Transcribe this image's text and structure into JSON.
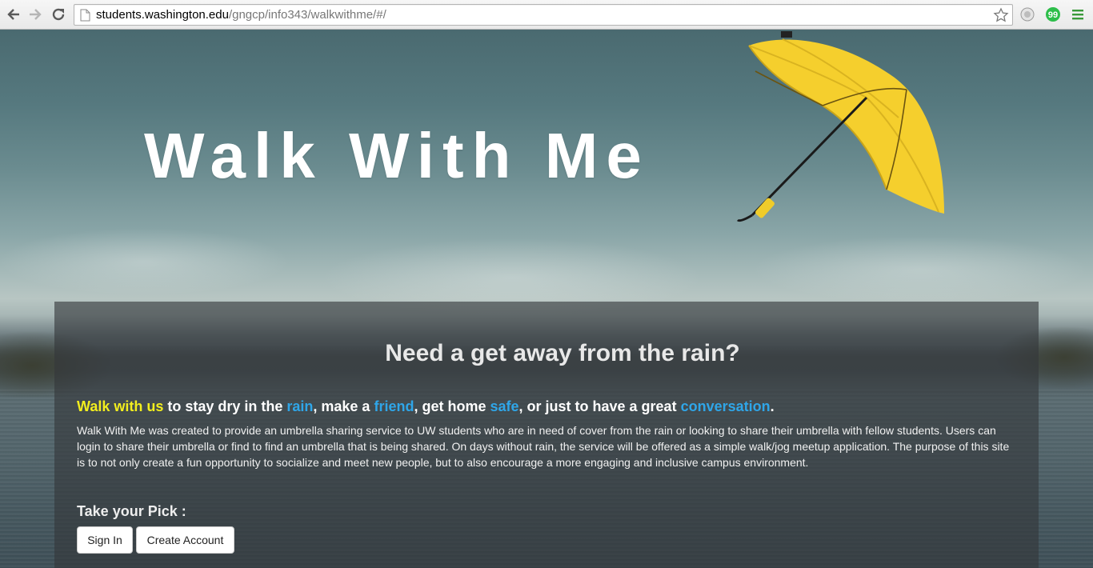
{
  "browser": {
    "url_host": "students.washington.edu",
    "url_path": "/gngcp/info343/walkwithme/#/",
    "icons": [
      "back-icon",
      "forward-icon",
      "reload-icon",
      "page-icon",
      "bookmark-star-icon",
      "extension-icon",
      "evernote-icon",
      "menu-icon"
    ]
  },
  "hero": {
    "title": "Walk With Me"
  },
  "panel": {
    "headline": "Need a get away from the rain?",
    "tagline": {
      "part1": "Walk with us",
      "part2": " to stay dry in the ",
      "part3": "rain",
      "part4": ", make a ",
      "part5": "friend",
      "part6": ", get home ",
      "part7": "safe",
      "part8": ", or just to have a great ",
      "part9": "conversation",
      "part10": "."
    },
    "description": "Walk With Me was created to provide an umbrella sharing service to UW students who are in need of cover from the rain or looking to share their umbrella with fellow students. Users can login to share their umbrella or find to find an umbrella that is being shared. On days without rain, the service will be offered as a simple walk/jog meetup application. The purpose of this site is to not only create a fun opportunity to socialize and meet new people, but to also encourage a more engaging and inclusive campus environment.",
    "pick_label": "Take your Pick :",
    "sign_in_label": "Sign In",
    "create_account_label": "Create Account"
  },
  "colors": {
    "highlight_yellow": "#f2ee1e",
    "highlight_blue": "#2fa6e8",
    "umbrella_yellow": "#f5cf2d"
  }
}
